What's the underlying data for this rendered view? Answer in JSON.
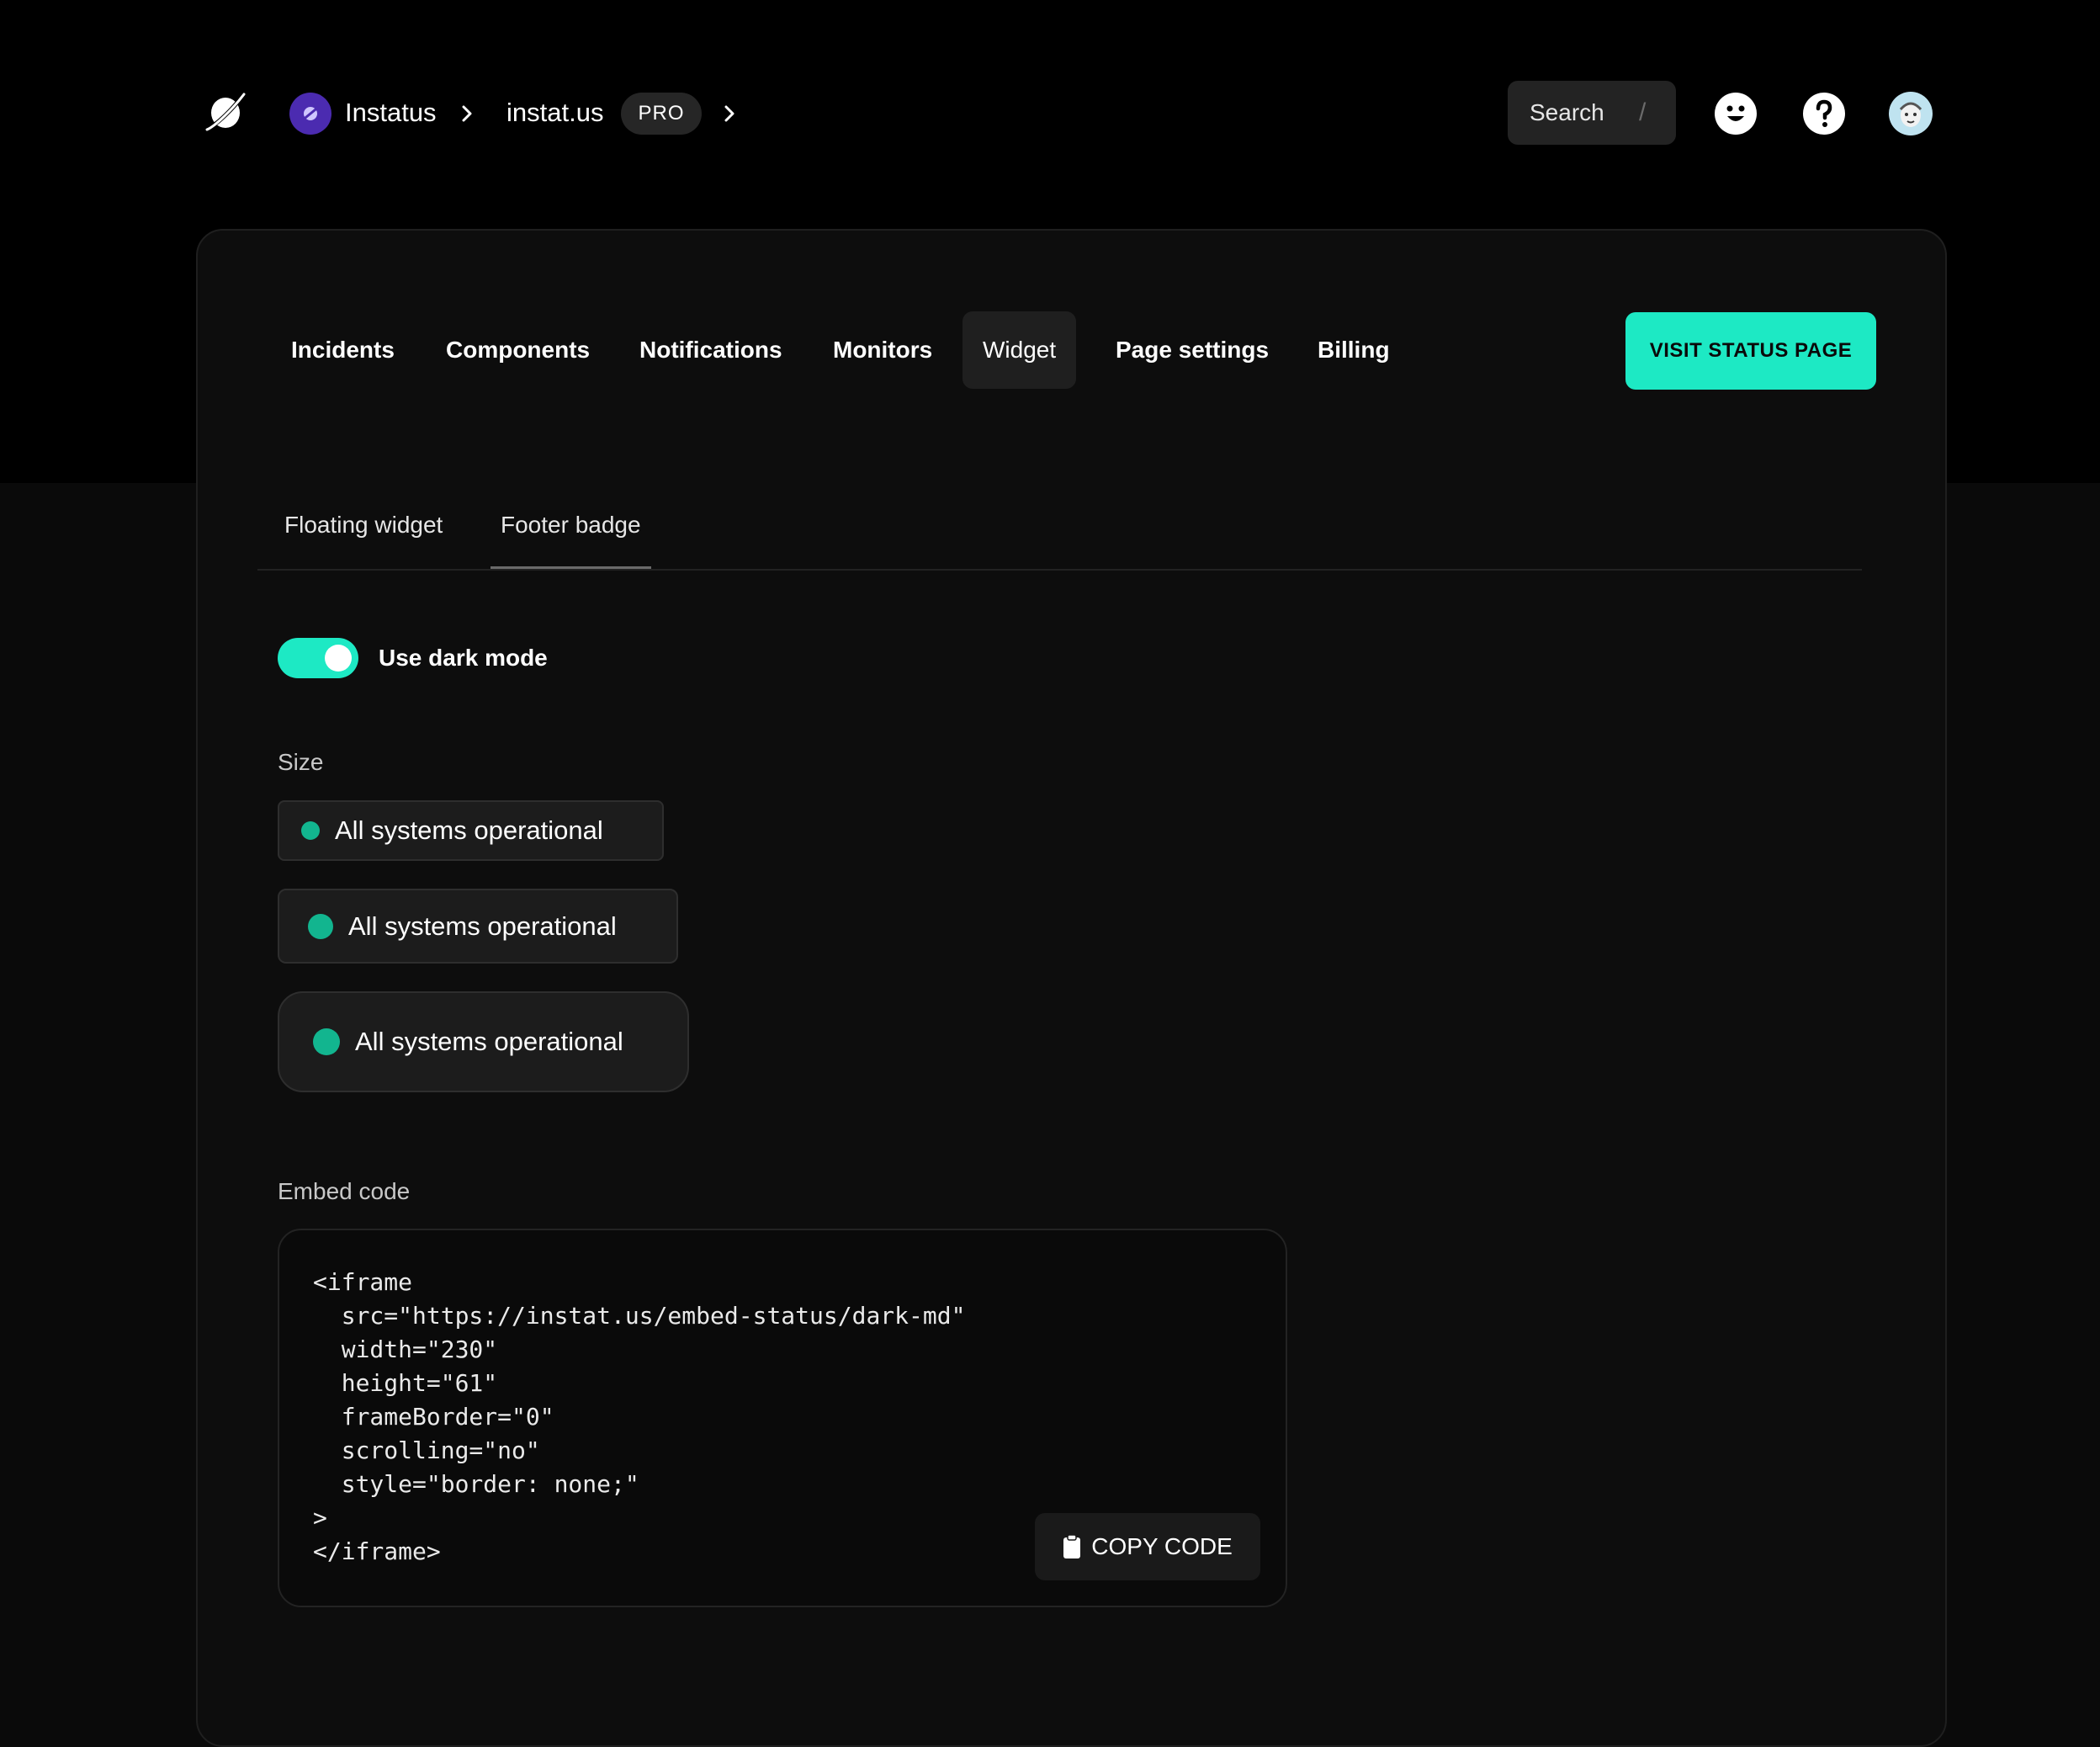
{
  "header": {
    "org_name": "Instatus",
    "page_name": "instat.us",
    "plan_badge": "PRO",
    "search_label": "Search",
    "search_shortcut": "/"
  },
  "nav": {
    "tabs": [
      {
        "label": "Incidents"
      },
      {
        "label": "Components"
      },
      {
        "label": "Notifications"
      },
      {
        "label": "Monitors"
      },
      {
        "label": "Widget",
        "active": true
      },
      {
        "label": "Page settings"
      },
      {
        "label": "Billing"
      }
    ],
    "visit_button": "VISIT STATUS PAGE"
  },
  "subtabs": {
    "items": [
      {
        "label": "Floating widget"
      },
      {
        "label": "Footer badge",
        "active": true
      }
    ]
  },
  "settings": {
    "dark_mode_label": "Use dark mode",
    "dark_mode_on": true,
    "size_label": "Size",
    "size_options": [
      {
        "label": "All systems operational",
        "size": "small"
      },
      {
        "label": "All systems operational",
        "size": "medium"
      },
      {
        "label": "All systems operational",
        "size": "large"
      }
    ],
    "embed_label": "Embed code",
    "embed_code": "<iframe\n  src=\"https://instat.us/embed-status/dark-md\"\n  width=\"230\"\n  height=\"61\"\n  frameBorder=\"0\"\n  scrolling=\"no\"\n  style=\"border: none;\"\n>\n</iframe>",
    "copy_button": "COPY CODE"
  },
  "colors": {
    "accent": "#1de9c4",
    "status_dot": "#12b58f",
    "org_avatar": "#4b2bb0"
  },
  "icons": [
    "planet-logo-icon",
    "chevron-right-icon",
    "smiley-icon",
    "help-icon",
    "user-avatar",
    "clipboard-icon"
  ]
}
